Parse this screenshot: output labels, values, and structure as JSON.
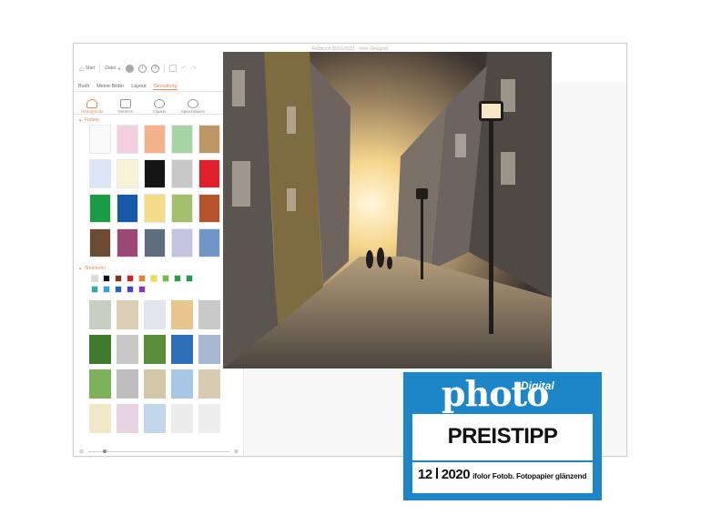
{
  "window": {
    "title": "Fotobuch 20/01/2021 - ifolor Designer"
  },
  "toolbar": {
    "start_label": "Start",
    "file_label": "Datei"
  },
  "sidebar": {
    "tabs": [
      {
        "label": "Buch"
      },
      {
        "label": "Meine Bilder"
      },
      {
        "label": "Layout"
      },
      {
        "label": "Gestaltung"
      }
    ],
    "tools": [
      {
        "label": "Hintergründe",
        "icon": "paint-bucket-icon"
      },
      {
        "label": "Rahmen",
        "icon": "frame-icon"
      },
      {
        "label": "Cliparts",
        "icon": "clipart-icon"
      },
      {
        "label": "Sprechblasen",
        "icon": "speech-bubble-icon"
      }
    ],
    "colors_section": "Farben",
    "structures_section": "Strukturen",
    "color_swatches": [
      "#fafafa",
      "#f4cfe0",
      "#f3b289",
      "#a6d4a4",
      "#be9766",
      "#dce6f7",
      "#f7f2d5",
      "#151515",
      "#c8c8c8",
      "#e01f2c",
      "#1a9b45",
      "#1a59a8",
      "#f5dc8b",
      "#a4bf6d",
      "#b5532a",
      "#6b4b33",
      "#9d4775",
      "#5f6d7d",
      "#c4c4e0",
      "#6f96c6"
    ],
    "pattern_dots": [
      "#d9d9d9",
      "#111111",
      "#8a2d1f",
      "#d8202a",
      "#ef7d22",
      "#f2e330",
      "#6fc33a",
      "#23a33b",
      "#1f9a4a"
    ],
    "pattern_dots_row2": [
      "#2ab1a6",
      "#2aa3df",
      "#1f62c4",
      "#4744c5",
      "#8c32c2"
    ],
    "textures": [
      "#c7cfc2",
      "#dbcfb5",
      "#e3e6ec",
      "#e8c48e",
      "#c9c9c9",
      "#3d7a2e",
      "#c8c8c8",
      "#5b8e3a",
      "#2f6eb8",
      "#a7b7cf",
      "#7db25a",
      "#bdbdbd",
      "#d4c7a8",
      "#a8c6e6",
      "#d9cbb2",
      "#f1e8c9",
      "#e8d4e0",
      "#c2d7ea",
      "#ececec",
      "#ededed"
    ]
  },
  "badge": {
    "brand_small": "Digital",
    "brand_big": "photo",
    "title": "PREISTIPP",
    "issue_left": "12",
    "issue_right": "2020",
    "product": "ifolor Fotob. Fotopapier glänzend"
  },
  "colors": {
    "accent": "#e98a52",
    "badge_blue": "#1d86c8"
  }
}
